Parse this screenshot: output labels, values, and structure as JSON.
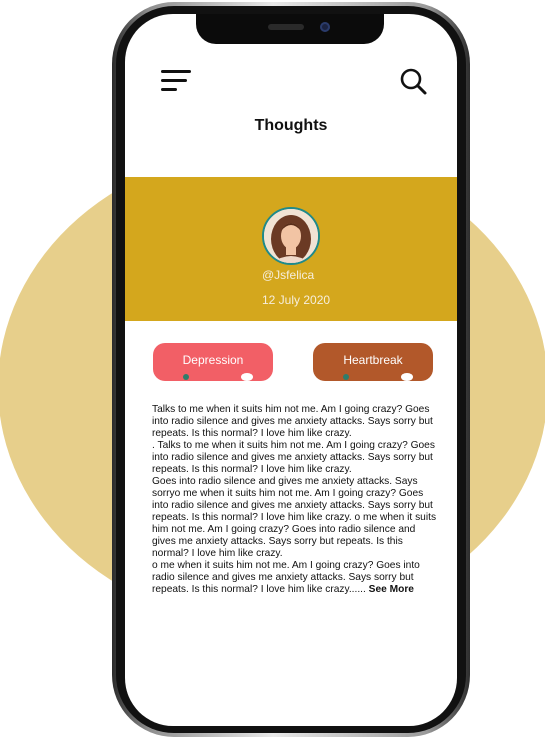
{
  "header": {
    "title": "Thoughts",
    "menu_icon": "hamburger-menu-icon",
    "search_icon": "search-icon"
  },
  "profile": {
    "username": "@Jsfelica",
    "date": "12 July 2020",
    "banner_color": "#d4a71d"
  },
  "tags": [
    {
      "label": "Depression",
      "color": "#f25f66"
    },
    {
      "label": "Heartbreak",
      "color": "#b2582a"
    }
  ],
  "post": {
    "paragraphs": [
      "Talks to me when it suits him not me. Am I going crazy? Goes into radio silence and gives me anxiety attacks. Says sorry but repeats. Is this normal? I love him like crazy.",
      ". Talks to me when it suits him not me. Am I going crazy? Goes into radio silence and gives me anxiety attacks. Says sorry but repeats. Is this normal? I love him like crazy.",
      "Goes into radio silence and gives me anxiety attacks. Says sorryo me when it suits him not me. Am I going crazy? Goes into radio silence and gives me anxiety attacks. Says sorry but repeats. Is this normal? I love him like crazy. o me when it suits him not me. Am I going crazy? Goes into radio silence and gives me anxiety attacks. Says sorry but repeats. Is this normal? I love him like crazy.",
      "o me when it suits him not me. Am I going crazy? Goes into radio silence and gives me anxiety attacks. Says sorry but repeats. Is this normal? I love him like crazy......"
    ],
    "see_more": "See More"
  },
  "colors": {
    "background_circle": "#e7cf8b",
    "accent_teal": "#1f8a8a"
  }
}
